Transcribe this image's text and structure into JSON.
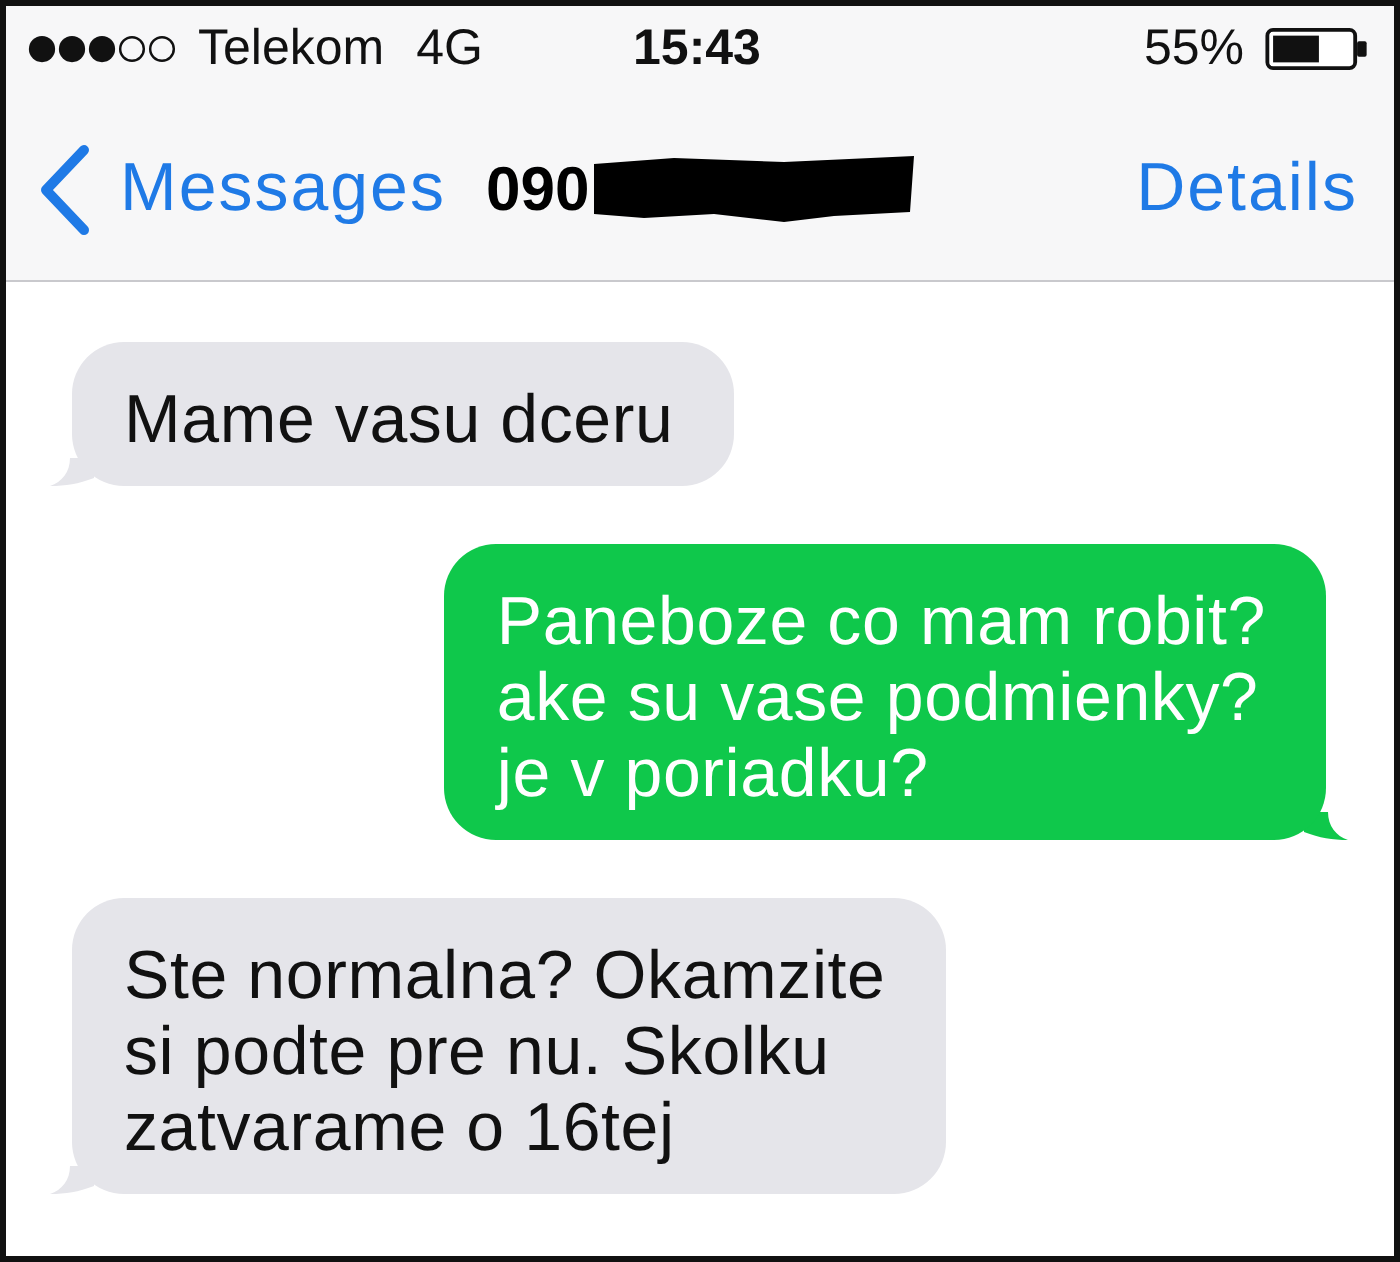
{
  "status_bar": {
    "carrier": "Telekom",
    "network": "4G",
    "time": "15:43",
    "battery": "55%"
  },
  "nav_bar": {
    "back": "Messages",
    "title": "090",
    "action": "Details"
  },
  "messages": [
    {
      "kind": "received",
      "text": "Mame vasu dceru"
    },
    {
      "kind": "sent",
      "text": "Paneboze co mam robit?\nake su vase podmienky?\nje v poriadku?"
    },
    {
      "kind": "received",
      "text": "Ste normalna? Okamzite\nsi podte pre nu. Skolku\nzatvarame o 16tej"
    }
  ]
}
